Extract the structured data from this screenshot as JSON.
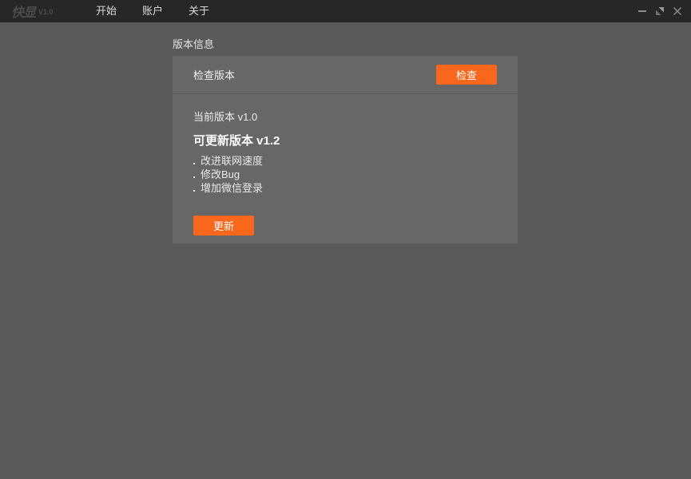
{
  "window": {
    "logo": "快显",
    "logo_version": "V1.0",
    "menu": [
      {
        "label": "开始"
      },
      {
        "label": "账户"
      },
      {
        "label": "关于"
      }
    ]
  },
  "page": {
    "title": "版本信息"
  },
  "version_card": {
    "check_label": "检查版本",
    "check_button": "检查",
    "current_version": "当前版本 v1.0",
    "update_version": "可更新版本 v1.2",
    "changelog": [
      "改进联网速度",
      "修改Bug",
      "增加微信登录"
    ],
    "update_button": "更新"
  },
  "colors": {
    "accent": "#F8671C",
    "titlebar": "#272727",
    "background": "#5A5A5B",
    "card": "#676768"
  }
}
